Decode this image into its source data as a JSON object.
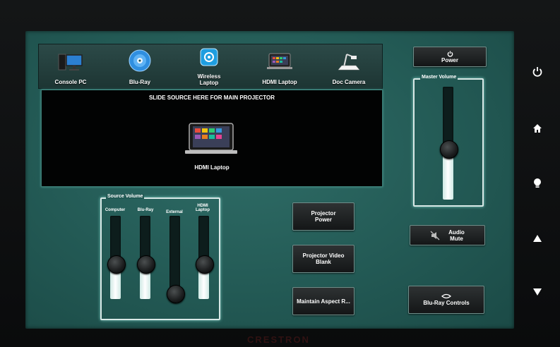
{
  "brand": "CRESTRON",
  "sources": [
    {
      "label": "Console PC",
      "icon": "console-pc-icon"
    },
    {
      "label": "Blu-Ray",
      "icon": "bluray-disc-icon"
    },
    {
      "label_line1": "Wireless",
      "label_line2": "Laptop",
      "icon": "wireless-icon"
    },
    {
      "label": "HDMI Laptop",
      "icon": "hdmi-laptop-icon"
    },
    {
      "label": "Doc Camera",
      "icon": "doc-camera-icon"
    }
  ],
  "drop_zone": {
    "title": "SLIDE SOURCE HERE FOR MAIN PROJECTOR",
    "current_source": "HDMI Laptop"
  },
  "source_volume": {
    "title": "Source Volume",
    "faders": [
      {
        "label": "Computer",
        "level": 0.42
      },
      {
        "label": "Blu-Ray",
        "level": 0.42
      },
      {
        "label": "External",
        "level": 0.0
      },
      {
        "label_line1": "HDMI",
        "label_line2": "Laptop",
        "level": 0.42
      }
    ]
  },
  "master_volume": {
    "title": "Master Volume",
    "level": 0.45
  },
  "power_button": {
    "label": "Power",
    "icon": "power-icon"
  },
  "projector_power": {
    "line1": "Projector",
    "line2": "Power"
  },
  "projector_blank": {
    "line1": "Projector Video",
    "line2": "Blank"
  },
  "maintain_aspect": {
    "label": "Maintain Aspect R..."
  },
  "audio_mute": {
    "line1": "Audio",
    "line2": "Mute",
    "icon": "speaker-muted-icon"
  },
  "bluray_controls": {
    "label": "Blu-Ray Controls",
    "icon": "bluray-logo-icon"
  },
  "side_nav": [
    "power-icon",
    "home-icon",
    "lightbulb-icon",
    "up-arrow-icon",
    "down-arrow-icon"
  ],
  "colors": {
    "panel": "#235a55",
    "accent": "#7fd0c6"
  }
}
